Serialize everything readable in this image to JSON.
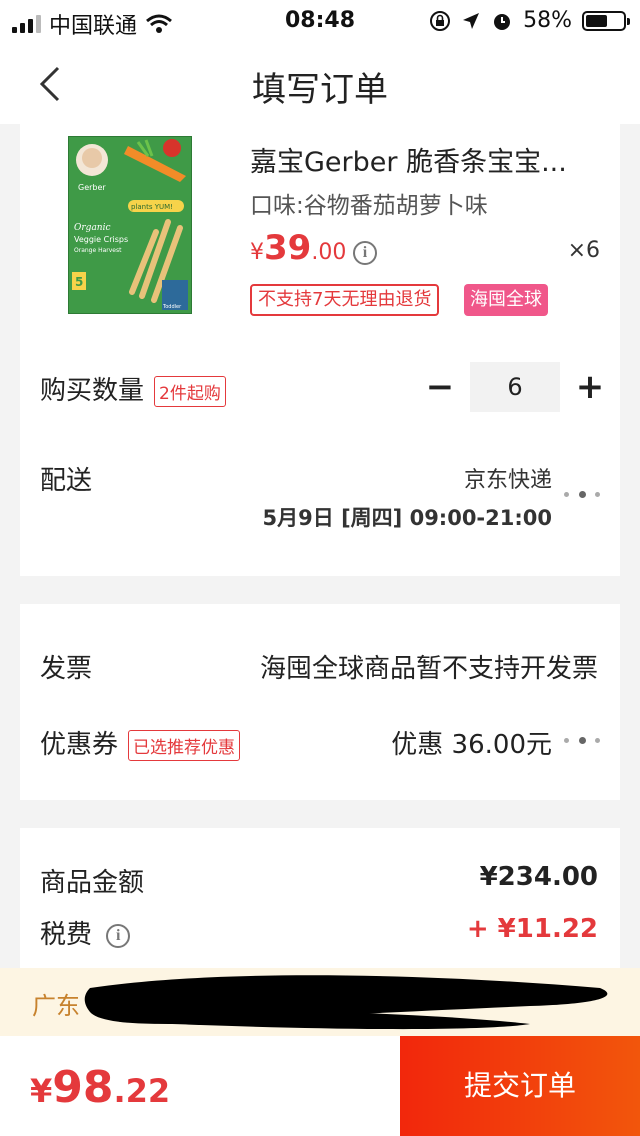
{
  "status_bar": {
    "carrier": "中国联通",
    "time": "08:48",
    "battery": "58%",
    "battery_level": 0.58
  },
  "nav": {
    "title": "填写订单"
  },
  "product": {
    "title": "嘉宝Gerber 脆香条宝宝...",
    "flavor": "口味:谷物番茄胡萝卜味",
    "price_symbol": "¥",
    "price_int": "39",
    "price_dec": ".00",
    "quantity_mark": "×6",
    "tag_return": "不支持7天无理由退货",
    "tag_global": "海囤全球",
    "image_text": {
      "brand": "Gerber",
      "badge": "plants YUM!",
      "line1": "Organic",
      "line2": "Veggie Crisps",
      "line3": "Orange Harvest",
      "count": "5",
      "age": "Toddler"
    }
  },
  "quantity": {
    "label": "购买数量",
    "min_tag": "2件起购",
    "minus": "−",
    "value": "6",
    "plus": "+"
  },
  "delivery": {
    "label": "配送",
    "carrier": "京东快递",
    "time": "5月9日 [周四] 09:00-21:00"
  },
  "invoice": {
    "label": "发票",
    "value": "海囤全球商品暂不支持开发票"
  },
  "coupon": {
    "label": "优惠券",
    "tag": "已选推荐优惠",
    "value": "优惠 36.00元"
  },
  "amounts": {
    "goods_label": "商品金额",
    "goods_value": "¥234.00",
    "tax_label": "税费",
    "tax_value": "+ ¥11.22"
  },
  "address": {
    "text": "广东"
  },
  "bottom": {
    "total_symbol": "¥",
    "total_int": "98",
    "total_dec": ".22",
    "submit": "提交订单"
  },
  "colors": {
    "accent": "#e4393c",
    "global_tag": "#f0578a",
    "submit_start": "#f2270c",
    "address_bg": "#fdf5e3"
  }
}
